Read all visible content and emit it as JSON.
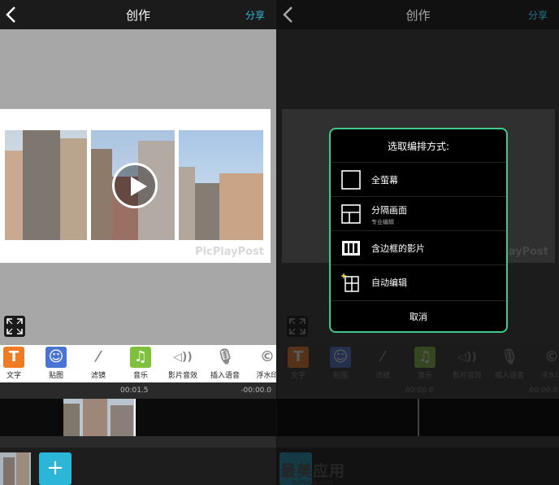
{
  "left": {
    "header": {
      "title": "创作",
      "share_label": "分享"
    },
    "preview": {
      "watermark": "PicPlayPost"
    },
    "toolbar": [
      {
        "label": "文字",
        "icon": "text-icon",
        "color": "#f07b22"
      },
      {
        "label": "贴图",
        "icon": "sticker-icon",
        "color": "#4a74d4"
      },
      {
        "label": "滤镜",
        "icon": "magic-wand-icon",
        "color": "#999999"
      },
      {
        "label": "音乐",
        "icon": "music-icon",
        "color": "#7ec13c"
      },
      {
        "label": "影片音效",
        "icon": "speaker-icon",
        "color": "#999999"
      },
      {
        "label": "插入语音",
        "icon": "microphone-icon",
        "color": "#999999"
      },
      {
        "label": "浮水印",
        "icon": "copyright-icon",
        "color": "#999999"
      }
    ],
    "timeline": {
      "current_time": "00:01.5",
      "remaining_time": "-00:00.0"
    },
    "add_label": "+"
  },
  "right": {
    "header": {
      "title": "创作",
      "share_label": "分享"
    },
    "preview": {
      "watermark": "PicPlayPost"
    },
    "toolbar": [
      {
        "label": "文字"
      },
      {
        "label": "贴图"
      },
      {
        "label": "滤镜"
      },
      {
        "label": "音乐"
      },
      {
        "label": "影片音效"
      },
      {
        "label": "插入语音"
      },
      {
        "label": "浮水印"
      }
    ],
    "timeline": {
      "current_time": "00:00.0",
      "remaining_time": "00:00.0"
    },
    "dialog": {
      "title": "选取编排方式:",
      "options": [
        {
          "label": "全萤幕",
          "sub": "",
          "icon": "fullscreen-layout-icon"
        },
        {
          "label": "分隔画面",
          "sub": "专业编辑",
          "icon": "split-layout-icon"
        },
        {
          "label": "含边框的影片",
          "sub": "",
          "icon": "framed-movie-icon"
        },
        {
          "label": "自动编辑",
          "sub": "",
          "icon": "auto-edit-icon"
        }
      ],
      "cancel_label": "取消"
    },
    "brand": {
      "name": "最美应用",
      "url": "zuimeia.com"
    }
  },
  "accent": "#38b7d9",
  "dialog_border": "#43c88c"
}
